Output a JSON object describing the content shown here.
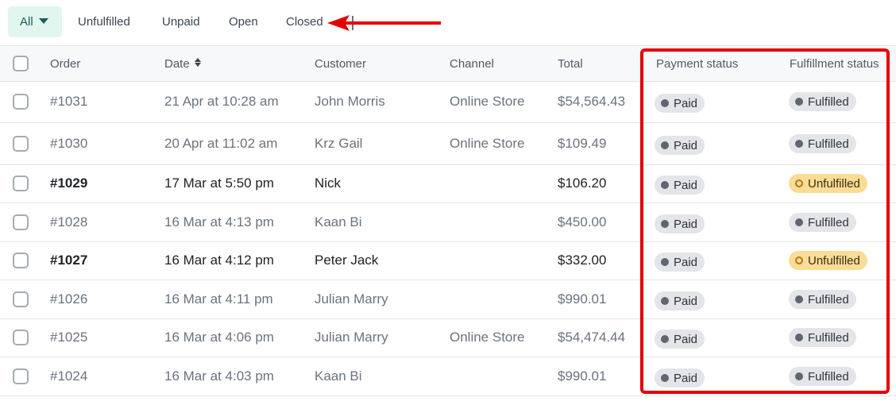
{
  "tabs": {
    "active_label": "All",
    "items": [
      "Unfulfilled",
      "Unpaid",
      "Open",
      "Closed"
    ]
  },
  "annotation": {
    "arrow_color": "#e50000",
    "highlight_color": "#e50000",
    "highlight_target": "Payment status and Fulfillment status columns"
  },
  "table": {
    "columns": {
      "order": "Order",
      "date": "Date",
      "customer": "Customer",
      "channel": "Channel",
      "total": "Total",
      "payment_status": "Payment status",
      "fulfillment_status": "Fulfillment status"
    },
    "rows": [
      {
        "order": "#1031",
        "date": "21 Apr at 10:28 am",
        "customer": "John Morris",
        "channel": "Online Store",
        "total": "$54,564.43",
        "payment": "Paid",
        "fulfillment": "Fulfilled"
      },
      {
        "order": "#1030",
        "date": "20 Apr at 11:02 am",
        "customer": "Krz Gail",
        "channel": "Online Store",
        "total": "$109.49",
        "payment": "Paid",
        "fulfillment": "Fulfilled"
      },
      {
        "order": "#1029",
        "date": "17 Mar at 5:50 pm",
        "customer": "Nick",
        "channel": "",
        "total": "$106.20",
        "payment": "Paid",
        "fulfillment": "Unfulfilled"
      },
      {
        "order": "#1028",
        "date": "16 Mar at 4:13 pm",
        "customer": "Kaan Bi",
        "channel": "",
        "total": "$450.00",
        "payment": "Paid",
        "fulfillment": "Fulfilled"
      },
      {
        "order": "#1027",
        "date": "16 Mar at 4:12 pm",
        "customer": "Peter Jack",
        "channel": "",
        "total": "$332.00",
        "payment": "Paid",
        "fulfillment": "Unfulfilled"
      },
      {
        "order": "#1026",
        "date": "16 Mar at 4:11 pm",
        "customer": "Julian Marry",
        "channel": "",
        "total": "$990.01",
        "payment": "Paid",
        "fulfillment": "Fulfilled"
      },
      {
        "order": "#1025",
        "date": "16 Mar at 4:06 pm",
        "customer": "Julian Marry",
        "channel": "Online Store",
        "total": "$54,474.44",
        "payment": "Paid",
        "fulfillment": "Fulfilled"
      },
      {
        "order": "#1024",
        "date": "16 Mar at 4:03 pm",
        "customer": "Kaan Bi",
        "channel": "",
        "total": "$990.01",
        "payment": "Paid",
        "fulfillment": "Fulfilled"
      }
    ]
  }
}
